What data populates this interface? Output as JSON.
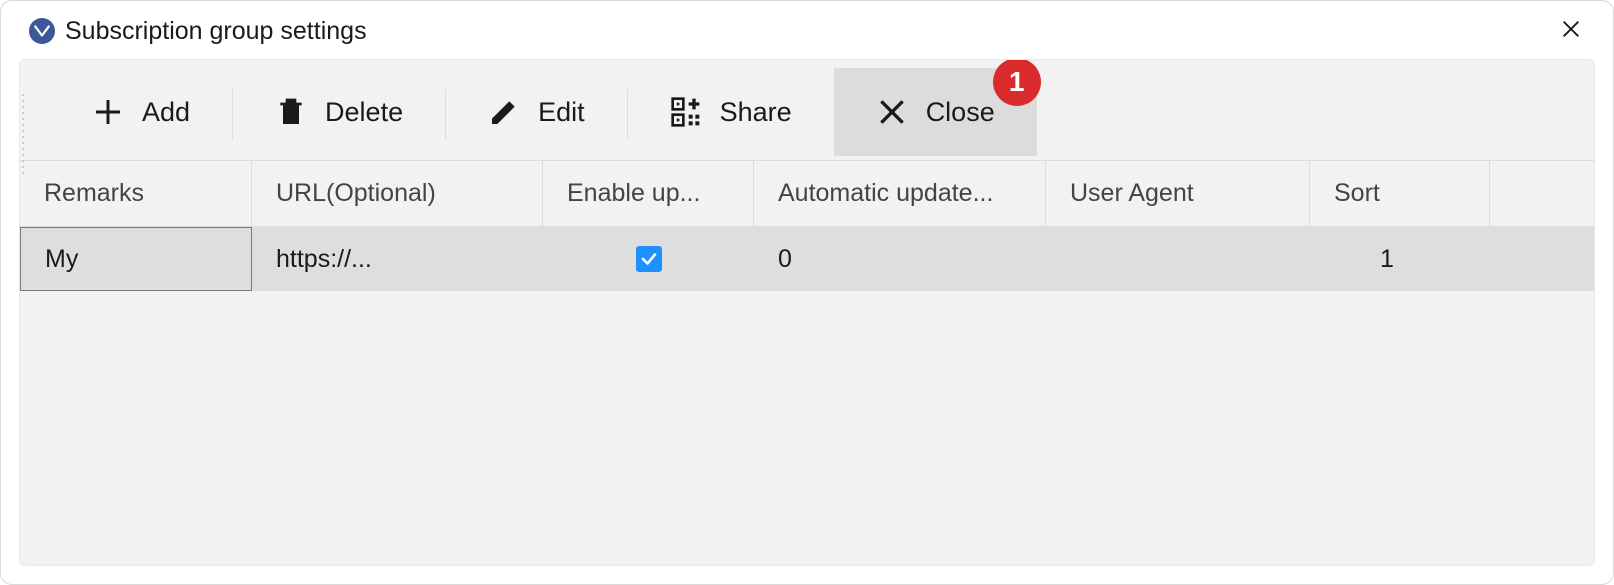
{
  "window": {
    "title": "Subscription group settings"
  },
  "toolbar": {
    "add_label": "Add",
    "delete_label": "Delete",
    "edit_label": "Edit",
    "share_label": "Share",
    "close_label": "Close",
    "badge_count": "1"
  },
  "table": {
    "headers": {
      "remarks": "Remarks",
      "url": "URL(Optional)",
      "enable": "Enable up...",
      "auto": "Automatic update...",
      "agent": "User Agent",
      "sort": "Sort"
    },
    "rows": [
      {
        "remarks": "My",
        "url": "https://...",
        "enable": true,
        "auto": "0",
        "agent": "",
        "sort": "1"
      }
    ]
  }
}
